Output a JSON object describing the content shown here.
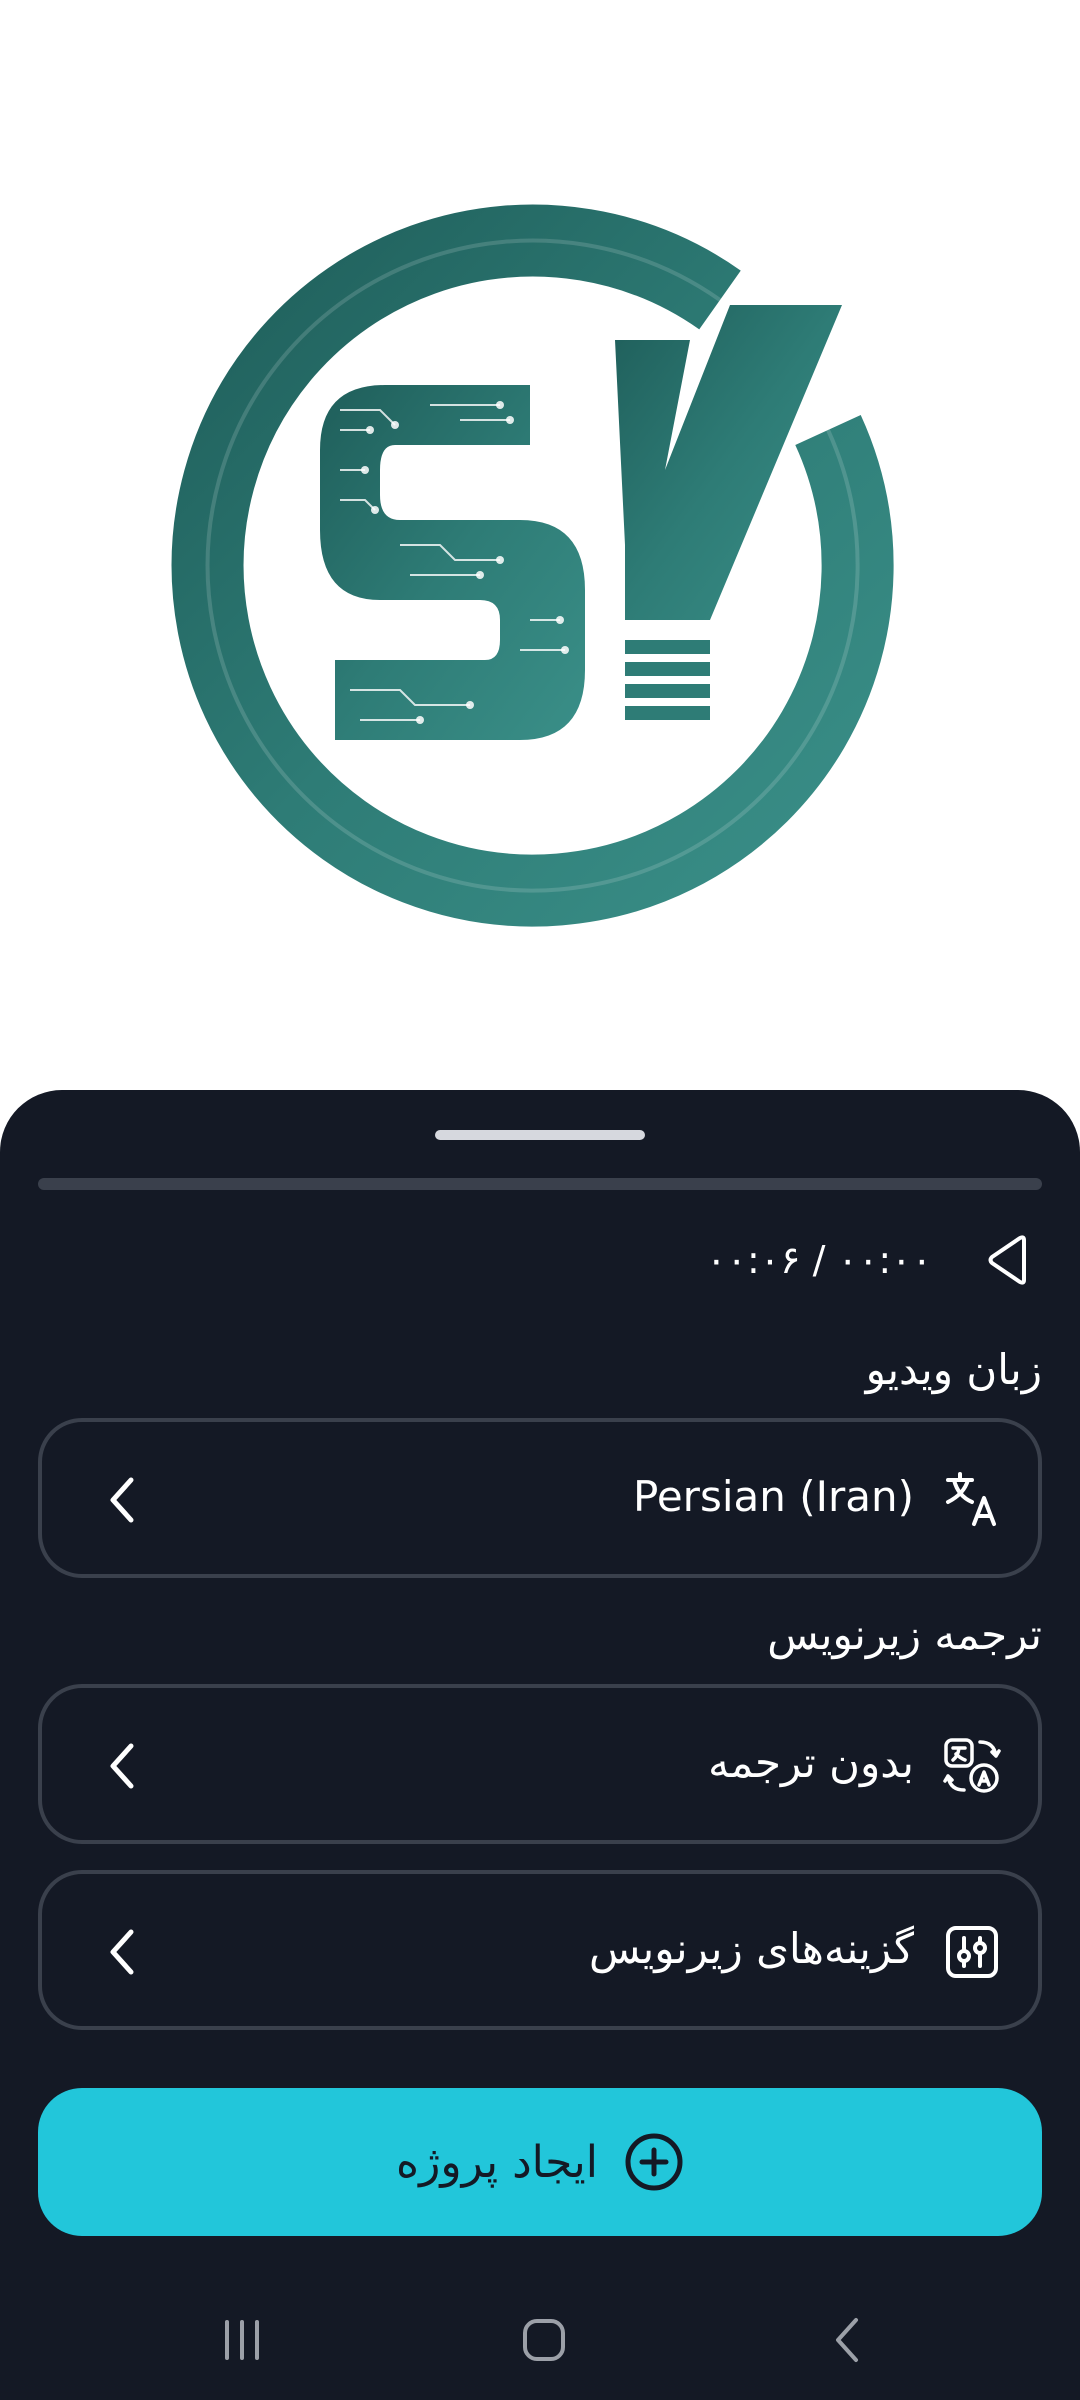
{
  "preview": {
    "logo_text": "SY",
    "colors": {
      "logo_teal": "#2e7c76",
      "logo_teal_dark": "#1f5e5a"
    }
  },
  "player": {
    "time_display": "۰۰:۰۶ / ۰۰:۰۰",
    "play_icon": "play-icon",
    "progress_fraction": 0
  },
  "video_language": {
    "label": "زبان ویدیو",
    "value": "Persian (Iran)",
    "icon": "translate-icon"
  },
  "subtitle_translation": {
    "label": "ترجمه زیرنویس",
    "value": "بدون ترجمه",
    "icon": "language-swap-icon"
  },
  "subtitle_options": {
    "value": "گزینه‌های زیرنویس",
    "icon": "sliders-icon"
  },
  "create_project": {
    "label": "ایجاد پروژه",
    "icon": "plus-circle-icon"
  },
  "colors": {
    "sheet_bg": "#141925",
    "accent": "#22c6da",
    "border": "#3a404c",
    "text": "#ffffff"
  },
  "system_nav": {
    "recents_icon": "recents-icon",
    "home_icon": "home-icon",
    "back_icon": "back-icon"
  }
}
